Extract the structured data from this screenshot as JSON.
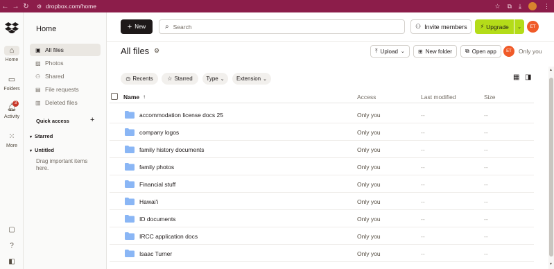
{
  "browser": {
    "back": "←",
    "forward": "→",
    "reload": "↻",
    "url": "dropbox.com/home"
  },
  "rail": {
    "items": [
      {
        "label": "Home",
        "icon": "home-icon"
      },
      {
        "label": "Folders",
        "icon": "folder-icon"
      },
      {
        "label": "Activity",
        "icon": "bell-icon",
        "badge": "3"
      },
      {
        "label": "More",
        "icon": "grid-icon"
      }
    ]
  },
  "sidebar": {
    "title": "Home",
    "items": [
      {
        "label": "All files"
      },
      {
        "label": "Photos"
      },
      {
        "label": "Shared"
      },
      {
        "label": "File requests"
      },
      {
        "label": "Deleted files"
      }
    ],
    "quick_access": "Quick access",
    "quick_access_add": "+",
    "groups": [
      "Starred",
      "Untitled"
    ],
    "drag_hint": "Drag important items here."
  },
  "header": {
    "new_label": "New",
    "search_placeholder": "Search",
    "invite_label": "Invite members",
    "upgrade_label": "Upgrade",
    "avatar_initials": "ET"
  },
  "main": {
    "title": "All files",
    "actions": {
      "upload": "Upload",
      "new_folder": "New folder",
      "open_app": "Open app"
    },
    "avatar_initials": "ET",
    "sharing": "Only you",
    "filters": [
      "Recents",
      "Starred",
      "Type",
      "Extension"
    ],
    "columns": {
      "name": "Name",
      "access": "Access",
      "modified": "Last modified",
      "size": "Size"
    },
    "rows": [
      {
        "name": "accommodation license docs 25",
        "access": "Only you",
        "modified": "--",
        "size": "--"
      },
      {
        "name": "company logos",
        "access": "Only you",
        "modified": "--",
        "size": "--"
      },
      {
        "name": "family history documents",
        "access": "Only you",
        "modified": "--",
        "size": "--"
      },
      {
        "name": "family photos",
        "access": "Only you",
        "modified": "--",
        "size": "--"
      },
      {
        "name": "Financial stuff",
        "access": "Only you",
        "modified": "--",
        "size": "--"
      },
      {
        "name": "Hawai'i",
        "access": "Only you",
        "modified": "--",
        "size": "--"
      },
      {
        "name": "ID documents",
        "access": "Only you",
        "modified": "--",
        "size": "--"
      },
      {
        "name": "IRCC application docs",
        "access": "Only you",
        "modified": "--",
        "size": "--"
      },
      {
        "name": "Isaac Turner",
        "access": "Only you",
        "modified": "--",
        "size": "--"
      }
    ]
  },
  "colors": {
    "browser_bar": "#8c1d4a",
    "upgrade": "#b4dc19",
    "avatar": "#f05a28",
    "folder": "#8ab6f5"
  }
}
